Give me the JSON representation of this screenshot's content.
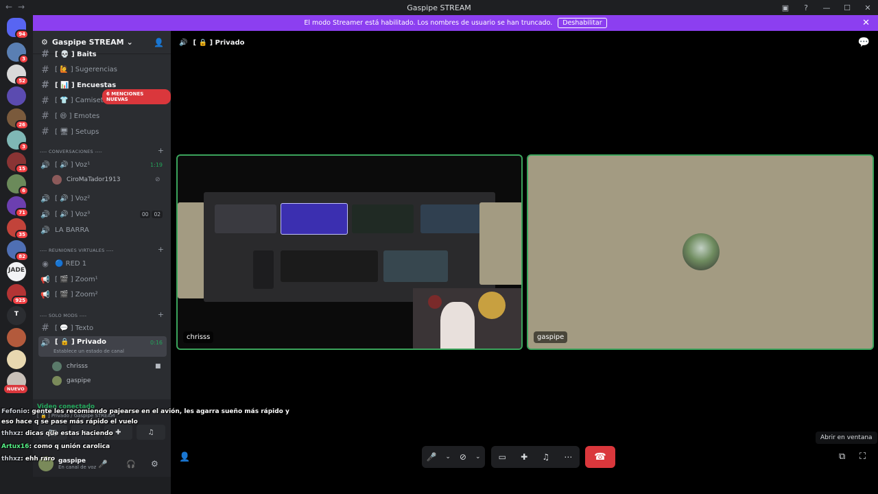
{
  "window": {
    "title": "Gaspipe STREAM",
    "nav_back": "←",
    "nav_forward": "→"
  },
  "banner": {
    "text": "El modo Streamer está habilitado. Los nombres de usuario se han truncado.",
    "button": "Deshabilitar"
  },
  "guilds": {
    "home_badge": "94",
    "items": [
      {
        "badge": "3",
        "color": "#5a7fb3"
      },
      {
        "badge": "52",
        "color": "#d9d9d9"
      },
      {
        "badge": "",
        "color": "#5b4bb0"
      },
      {
        "badge": "26",
        "color": "#7a5a3c"
      },
      {
        "badge": "3",
        "color": "#7fb7b5"
      },
      {
        "badge": "15",
        "color": "#8a3434"
      },
      {
        "badge": "6",
        "color": "#6b8a5a"
      },
      {
        "badge": "71",
        "color": "#6c3fb0"
      },
      {
        "badge": "35",
        "color": "#c2433a"
      },
      {
        "badge": "82",
        "color": "#4f6fb3"
      },
      {
        "badge": "",
        "color": "#f2f3f5",
        "label": "JADE"
      },
      {
        "badge": "925",
        "color": "#b33434"
      },
      {
        "badge": "",
        "color": "#2b2d31",
        "label": "T"
      },
      {
        "badge": "",
        "color": "#b35a3c"
      },
      {
        "badge": "",
        "color": "#e8d8b0"
      },
      {
        "badge": "",
        "color": "#c8c0b8"
      }
    ],
    "new_label": "NUEVO"
  },
  "server": {
    "name": "Gaspipe STREAM",
    "mentions_pill": "6 MENCIONES NUEVAS",
    "channels_top": [
      {
        "icon": "#",
        "label": "[ 💀 ] Baits",
        "bright": true
      },
      {
        "icon": "#",
        "label": "[ 🙋 ] Sugerencias",
        "bright": false
      },
      {
        "icon": "#",
        "label": "[ 📊 ] Encuestas",
        "bright": true
      },
      {
        "icon": "#",
        "label": "[ 👕 ] Camisetas",
        "bright": false
      },
      {
        "icon": "#",
        "label": "[ 😄 ] Emotes",
        "bright": false
      },
      {
        "icon": "#",
        "label": "[ 🖥 ] Setups",
        "bright": false
      }
    ],
    "cat_conversaciones": "---- CONVERSACIONES ----",
    "voz1": {
      "label": "[ 🔊 ] Voz¹",
      "time": "1:19"
    },
    "voz1_user": "CiroMaTador1913",
    "voz2": {
      "label": "[ 🔊 ] Voz²"
    },
    "voz3": {
      "label": "[ 🔊 ] Voz³",
      "count_a": "00",
      "count_b": "02"
    },
    "la_barra": "LA BARRA",
    "cat_reuniones": "---- REUNIONES VIRTUALES ----",
    "red1": "🔵 RED 1",
    "zoom1": "[ 🎬 ] Zoom¹",
    "zoom2": "[ 🎬 ] Zoom²",
    "cat_mods": "---- SOLO MODS ----",
    "texto": "[ 💬 ] Texto",
    "privado": {
      "label": "[ 🔒 ] Privado",
      "time": "0:16",
      "status": "Establece un estado de canal"
    },
    "privado_users": [
      "chrisss",
      "gaspipe"
    ]
  },
  "voice_panel": {
    "status": "Video conectado",
    "location": "[ 🔒 ] Privado / Gaspipe STREAM",
    "username": "gaspipe",
    "substatus": "En canal de voz"
  },
  "main": {
    "channel": "[ 🔒 ] Privado",
    "tile_left_label": "chrisss",
    "tile_right_label": "gaspipe",
    "tooltip": "Abrir en ventana"
  },
  "chat_overlay": [
    {
      "user": "Fefonio",
      "text": ": gente les recomiendo pajearse en el avión, les agarra sueño más rápido y",
      "green": false
    },
    {
      "user": "",
      "text": "eso hace q se pase más rápido el vuelo",
      "green": false
    },
    {
      "user": "thhxz",
      "text": ": dicas que estas haciendo",
      "green": false
    },
    {
      "user": "Artux16",
      "text": ": como q unión carolica",
      "green": true
    },
    {
      "user": "thhxz",
      "text": ": ehh raro",
      "green": false
    }
  ]
}
